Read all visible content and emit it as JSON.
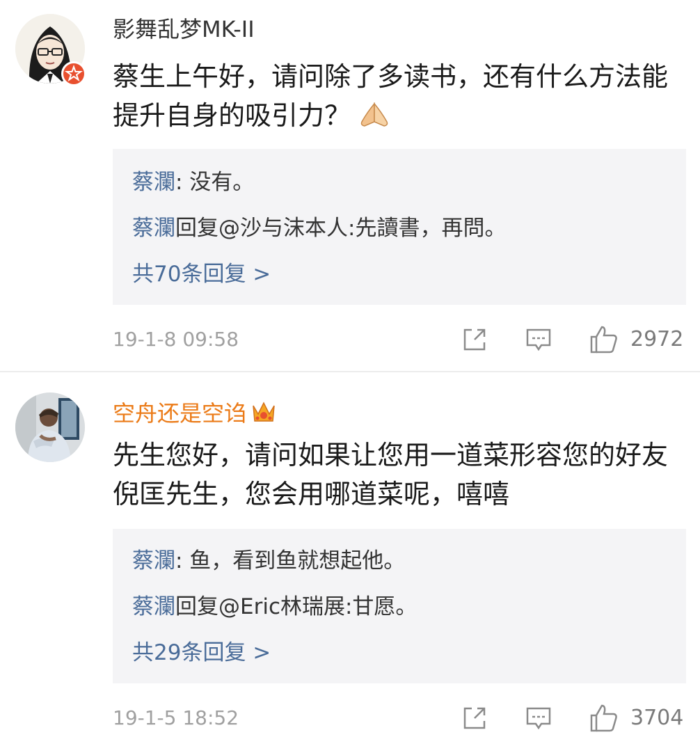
{
  "comments": [
    {
      "username": "影舞乱梦MK-II",
      "avatar_icon": "anime-girl-glasses-avatar",
      "badge_icon": "verified-badge-icon",
      "text": "蔡生上午好，请问除了多读书，还有什么方法能提升自身的吸引力？",
      "text_emoji": "praying-hands-emoji",
      "replies": [
        {
          "author": "蔡瀾",
          "text": ": 没有。"
        },
        {
          "author": "蔡瀾",
          "text": "回复@沙与沫本人:先讀書，再問。"
        }
      ],
      "more_replies": "共70条回复 >",
      "timestamp": "19-1-8 09:58",
      "like_count": "2972"
    },
    {
      "username": "空舟还是空诌",
      "avatar_icon": "person-photo-avatar",
      "username_badge": "crown-badge-icon",
      "text": "先生您好，请问如果让您用一道菜形容您的好友倪匡先生，您会用哪道菜呢，嘻嘻",
      "replies": [
        {
          "author": "蔡瀾",
          "text": ": 鱼，看到鱼就想起他。"
        },
        {
          "author": "蔡瀾",
          "text": "回复@Eric林瑞展:甘愿。"
        }
      ],
      "more_replies": "共29条回复 >",
      "timestamp": "19-1-5 18:52",
      "like_count": "3704"
    }
  ],
  "colors": {
    "username_vip": "#eb7b18",
    "reply_author": "#4a6c99",
    "reply_bg": "#f4f4f6",
    "timestamp": "#a0a0a0",
    "badge": "#e8502f"
  }
}
